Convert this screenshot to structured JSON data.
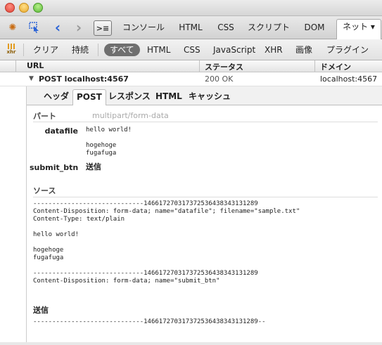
{
  "toolbar": {
    "icons": [
      "firebug-icon",
      "inspect-icon",
      "back-icon",
      "forward-icon",
      "console-toggle-icon"
    ],
    "tabs": [
      {
        "label": "コンソール"
      },
      {
        "label": "HTML"
      },
      {
        "label": "CSS"
      },
      {
        "label": "スクリプト"
      },
      {
        "label": "DOM"
      },
      {
        "label": "ネット ▾"
      }
    ]
  },
  "filterbar": {
    "clear": "クリア",
    "persist": "持続",
    "filters": [
      "すべて",
      "HTML",
      "CSS",
      "JavaScript",
      "XHR",
      "画像",
      "プラグイン"
    ]
  },
  "columns": {
    "url": "URL",
    "status": "ステータス",
    "domain": "ドメイン"
  },
  "request": {
    "url": "POST localhost:4567",
    "status": "200 OK",
    "domain": "localhost:4567"
  },
  "subtabs": [
    "ヘッダ",
    "POST",
    "レスポンス",
    "HTML",
    "キャッシュ"
  ],
  "post": {
    "parts_label": "パート",
    "parts_type": "multipart/form-data",
    "params": [
      {
        "name": "datafile",
        "value": "hello world!\n\nhogehoge\nfugafuga"
      },
      {
        "name": "submit_btn",
        "value": "送信"
      }
    ],
    "source_label": "ソース",
    "source_block1": "-----------------------------146617270317372536438343131289\nContent-Disposition: form-data; name=\"datafile\"; filename=\"sample.txt\"\nContent-Type: text/plain\n\nhello world!\n\nhogehoge\nfugafuga\n\n-----------------------------146617270317372536438343131289\nContent-Disposition: form-data; name=\"submit_btn\"",
    "source_value": "送信",
    "source_end": "-----------------------------146617270317372536438343131289--"
  }
}
